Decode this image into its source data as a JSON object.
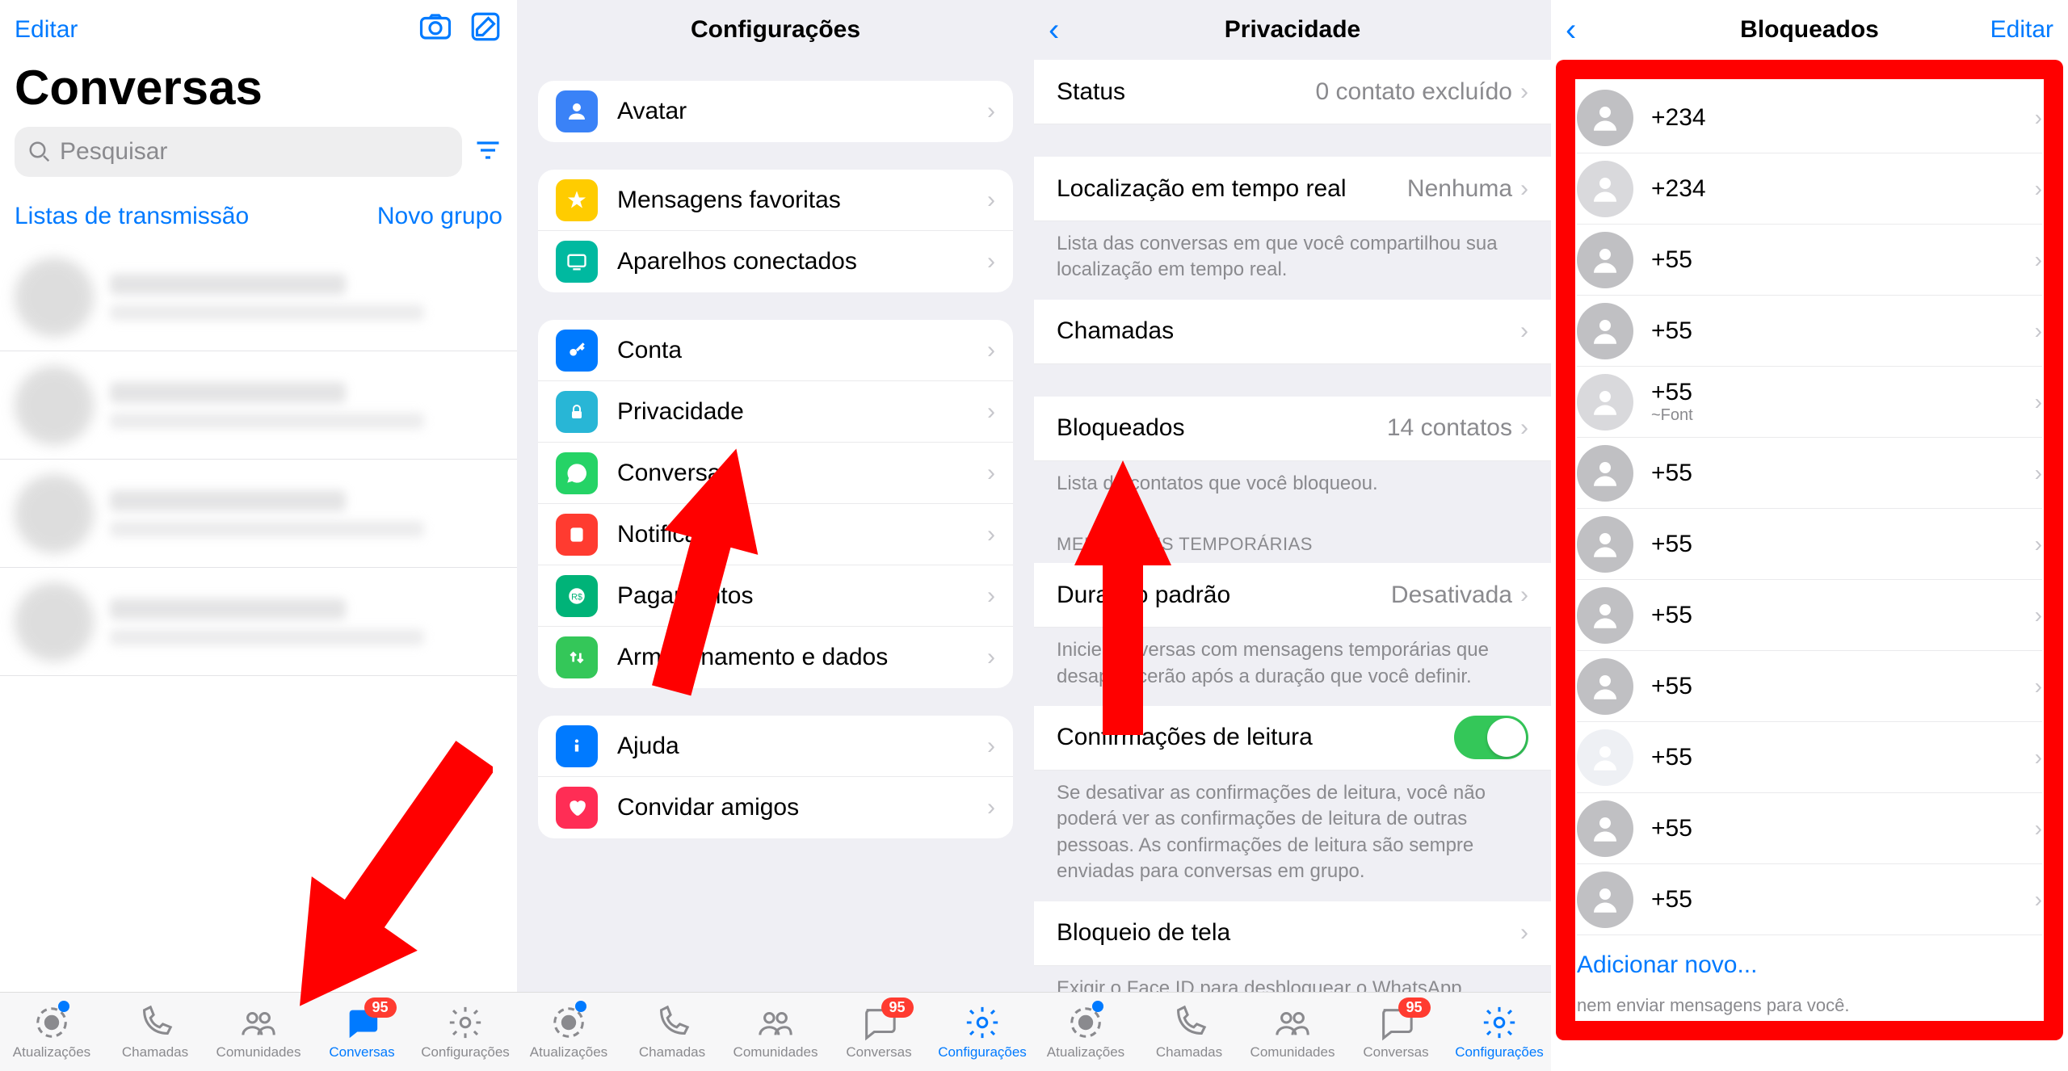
{
  "panel1": {
    "header_left": "Editar",
    "title": "Conversas",
    "search_placeholder": "Pesquisar",
    "broadcast": "Listas de transmissão",
    "newgroup": "Novo grupo",
    "badge": "95"
  },
  "panel2": {
    "title": "Configurações",
    "groups": [
      [
        "Avatar"
      ],
      [
        "Mensagens favoritas",
        "Aparelhos conectados"
      ],
      [
        "Conta",
        "Privacidade",
        "Conversas",
        "Notificações",
        "Pagamentos",
        "Armazenamento e dados"
      ],
      [
        "Ajuda",
        "Convidar amigos"
      ]
    ],
    "badge": "95"
  },
  "panel3": {
    "title": "Privacidade",
    "status_label": "Status",
    "status_value": "0 contato excluído",
    "loc_label": "Localização em tempo real",
    "loc_value": "Nenhuma",
    "loc_note": "Lista das conversas em que você compartilhou sua localização em tempo real.",
    "calls_label": "Chamadas",
    "blocked_label": "Bloqueados",
    "blocked_value": "14 contatos",
    "blocked_note": "Lista de contatos que você bloqueou.",
    "temp_header": "MENSAGENS TEMPORÁRIAS",
    "duration_label": "Duração padrão",
    "duration_value": "Desativada",
    "duration_note": "Inicie conversas com mensagens temporárias que desaparecerão após a duração que você definir.",
    "read_label": "Confirmações de leitura",
    "read_note": "Se desativar as confirmações de leitura, você não poderá ver as confirmações de leitura de outras pessoas. As confirmações de leitura são sempre enviadas para conversas em grupo.",
    "lock_label": "Bloqueio de tela",
    "lock_note": "Exigir o Face ID para desbloquear o WhatsApp.",
    "badge": "95"
  },
  "panel4": {
    "title": "Bloqueados",
    "header_right": "Editar",
    "contacts": [
      {
        "num": "+234",
        "sub": ""
      },
      {
        "num": "+234",
        "sub": ""
      },
      {
        "num": "+55",
        "sub": ""
      },
      {
        "num": "+55",
        "sub": ""
      },
      {
        "num": "+55",
        "sub": "~Font"
      },
      {
        "num": "+55",
        "sub": ""
      },
      {
        "num": "+55",
        "sub": ""
      },
      {
        "num": "+55",
        "sub": ""
      },
      {
        "num": "+55",
        "sub": ""
      },
      {
        "num": "+55",
        "sub": ""
      },
      {
        "num": "+55",
        "sub": ""
      },
      {
        "num": "+55",
        "sub": ""
      }
    ],
    "addnew": "Adicionar novo...",
    "footnote": "nem enviar mensagens para você."
  },
  "tabs": {
    "updates": "Atualizações",
    "calls": "Chamadas",
    "communities": "Comunidades",
    "chats": "Conversas",
    "settings": "Configurações"
  },
  "icons": {
    "avatar_bg": "#3a82f7",
    "fav_bg": "#ffcc00",
    "devices_bg": "#00b9a0",
    "account_bg": "#007aff",
    "privacy_bg": "#28b6d6",
    "chats_bg": "#25d366",
    "notif_bg": "#ff3b30",
    "pay_bg": "#00b378",
    "storage_bg": "#34c759",
    "help_bg": "#007aff",
    "invite_bg": "#ff2d55"
  }
}
